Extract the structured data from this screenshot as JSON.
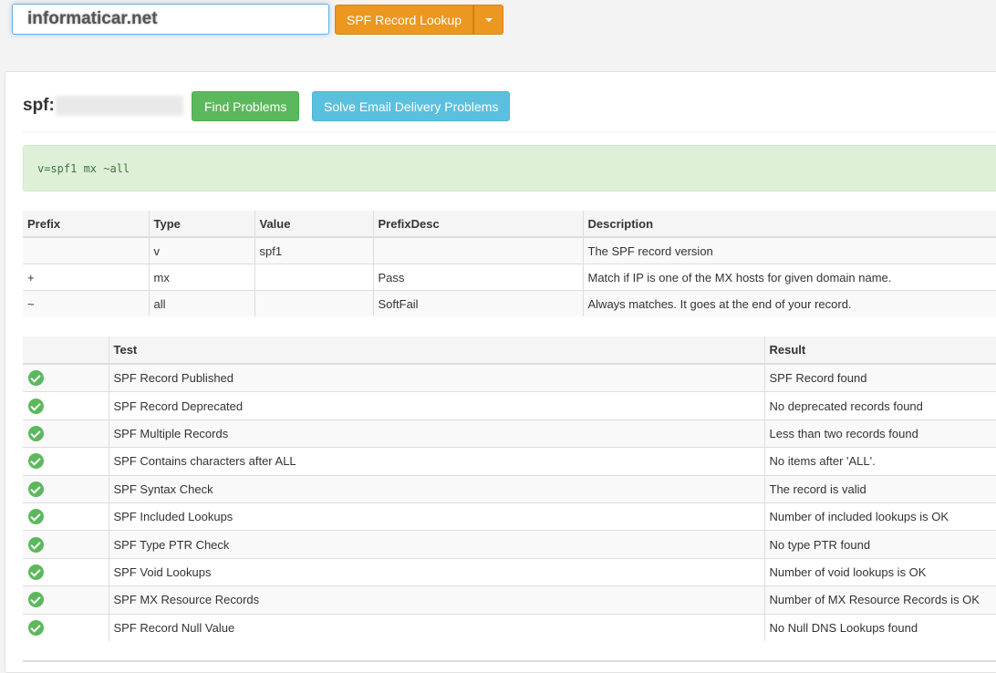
{
  "lookup": {
    "domain": "informaticar.net",
    "button_label": "SPF Record Lookup"
  },
  "result": {
    "spf_label": "spf:",
    "find_problems_label": "Find Problems",
    "solve_email_label": "Solve Email Delivery Problems",
    "record": "v=spf1 mx ~all"
  },
  "prefix_table": {
    "headers": [
      "Prefix",
      "Type",
      "Value",
      "PrefixDesc",
      "Description"
    ],
    "rows": [
      [
        "",
        "v",
        "spf1",
        "",
        "The SPF record version"
      ],
      [
        "+",
        "mx",
        "",
        "Pass",
        "Match if IP is one of the MX hosts for given domain name."
      ],
      [
        "~",
        "all",
        "",
        "SoftFail",
        "Always matches. It goes at the end of your record."
      ]
    ]
  },
  "test_table": {
    "headers": [
      "",
      "Test",
      "Result"
    ],
    "status_icon": "check-circle-icon",
    "status_color": "#5cb85c",
    "rows": [
      [
        "SPF Record Published",
        "SPF Record found"
      ],
      [
        "SPF Record Deprecated",
        "No deprecated records found"
      ],
      [
        "SPF Multiple Records",
        "Less than two records found"
      ],
      [
        "SPF Contains characters after ALL",
        "No items after 'ALL'."
      ],
      [
        "SPF Syntax Check",
        "The record is valid"
      ],
      [
        "SPF Included Lookups",
        "Number of included lookups is OK"
      ],
      [
        "SPF Type PTR Check",
        "No type PTR found"
      ],
      [
        "SPF Void Lookups",
        "Number of void lookups is OK"
      ],
      [
        "SPF MX Resource Records",
        "Number of MX Resource Records is OK"
      ],
      [
        "SPF Record Null Value",
        "No Null DNS Lookups found"
      ]
    ]
  }
}
